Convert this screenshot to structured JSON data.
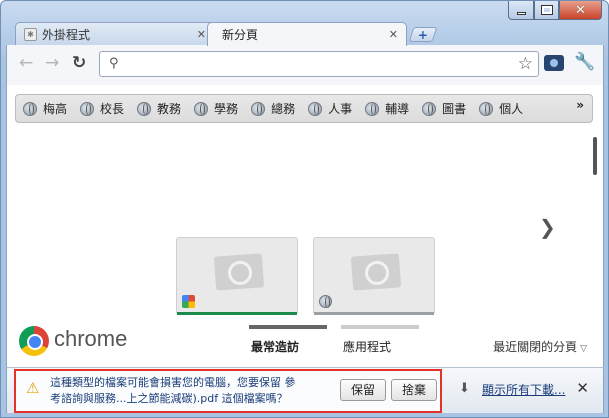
{
  "tabs": [
    {
      "label": "外掛程式",
      "active": false
    },
    {
      "label": "新分頁",
      "active": true
    }
  ],
  "omnibox": {
    "value": "",
    "placeholder": ""
  },
  "bookmarks": [
    "梅高",
    "校長",
    "教務",
    "學務",
    "總務",
    "人事",
    "輔導",
    "圖書",
    "個人"
  ],
  "ntp": {
    "logo_text": "chrome",
    "tab_most_visited": "最常造訪",
    "tab_apps": "應用程式",
    "recently_closed": "最近關閉的分頁"
  },
  "download_shelf": {
    "warning_line1": "這種類型的檔案可能會損害您的電腦，您要保留 參",
    "warning_line2": "考諮詢與服務...上之節能減碳).pdf 這個檔案嗎？",
    "keep_label": "保留",
    "discard_label": "捨棄",
    "show_all_label": "顯示所有下載..."
  },
  "colors": {
    "frame": "#a9c3e2",
    "highlight_border": "#e3322a",
    "link": "#1a3d7a"
  }
}
